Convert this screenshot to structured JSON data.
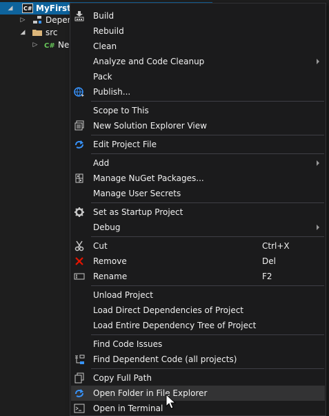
{
  "colors": {
    "selection": "#0e639c",
    "menu_background": "#1b1b1c",
    "menu_highlight": "#333334",
    "icon_blue": "#3794ff",
    "icon_red": "#e51400",
    "csharp_green": "#68c85a"
  },
  "tree": {
    "project_label": "MyFirstBl",
    "dependencies_label": "Deper",
    "src_label": "src",
    "file_label": "Ne",
    "project_icon": "csharp-project-icon",
    "dependencies_icon": "dependencies-icon",
    "src_icon": "folder-icon",
    "file_icon": "csharp-file-icon"
  },
  "menu": {
    "items": [
      {
        "label": "Build",
        "icon": "build-icon"
      },
      {
        "label": "Rebuild"
      },
      {
        "label": "Clean"
      },
      {
        "label": "Analyze and Code Cleanup",
        "submenu": true
      },
      {
        "label": "Pack"
      },
      {
        "label": "Publish...",
        "icon": "publish-globe-icon"
      },
      {
        "label": "Scope to This"
      },
      {
        "label": "New Solution Explorer View",
        "icon": "new-view-icon"
      },
      {
        "label": "Edit Project File",
        "icon": "edit-project-icon"
      },
      {
        "label": "Add",
        "submenu": true
      },
      {
        "label": "Manage NuGet Packages...",
        "icon": "nuget-icon"
      },
      {
        "label": "Manage User Secrets"
      },
      {
        "label": "Set as Startup Project",
        "icon": "gear-icon"
      },
      {
        "label": "Debug",
        "submenu": true
      },
      {
        "label": "Cut",
        "shortcut": "Ctrl+X",
        "icon": "scissors-icon"
      },
      {
        "label": "Remove",
        "shortcut": "Del",
        "icon": "remove-x-icon"
      },
      {
        "label": "Rename",
        "shortcut": "F2",
        "icon": "rename-icon"
      },
      {
        "label": "Unload Project"
      },
      {
        "label": "Load Direct Dependencies of Project"
      },
      {
        "label": "Load Entire Dependency Tree of Project"
      },
      {
        "label": "Find Code Issues"
      },
      {
        "label": "Find Dependent Code (all projects)",
        "icon": "dependent-code-icon"
      },
      {
        "label": "Copy Full Path",
        "icon": "copy-icon"
      },
      {
        "label": "Open Folder in File Explorer",
        "icon": "open-folder-icon",
        "highlighted": true
      },
      {
        "label": "Open in Terminal",
        "icon": "terminal-icon"
      }
    ]
  }
}
